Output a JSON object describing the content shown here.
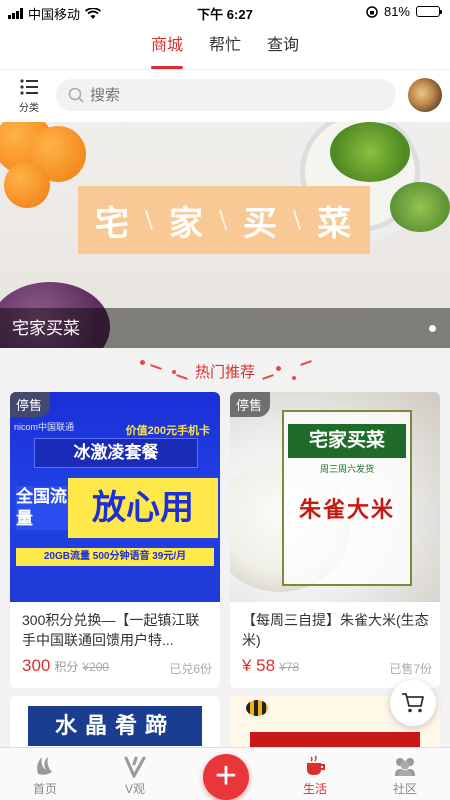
{
  "status_bar": {
    "carrier": "中国移动",
    "time": "下午 6:27",
    "battery": "81%",
    "battery_level": 0.81
  },
  "top_tabs": [
    {
      "label": "商城",
      "active": true
    },
    {
      "label": "帮忙",
      "active": false
    },
    {
      "label": "查询",
      "active": false
    }
  ],
  "search": {
    "category_label": "分类",
    "placeholder": "搜索"
  },
  "banner": {
    "title_chars": [
      "宅",
      "家",
      "买",
      "菜"
    ],
    "caption": "宅家买菜"
  },
  "section": {
    "title": "热门推荐"
  },
  "products": [
    {
      "badge": "停售",
      "title": "300积分兑换—【一起镇江联手中国联通回馈用户特...",
      "price": "300",
      "price_unit": "积分",
      "original_price": "¥200",
      "sold": "已兑6份",
      "poster": {
        "top_text": "价值200元手机卡",
        "logo": "nicom中国联通",
        "headline": "冰激凌套餐",
        "left_text": "全国流量",
        "big_text": "放心用",
        "strip": "20GB流量 500分钟语音 39元/月"
      }
    },
    {
      "badge": "停售",
      "title": "【每周三自提】朱雀大米(生态米)",
      "price": "¥ 58",
      "price_unit": "",
      "original_price": "¥78",
      "sold": "已售7份",
      "poster": {
        "title": "宅家买菜",
        "subtitle": "周三周六发货",
        "rice": "朱雀大米"
      }
    }
  ],
  "partial_products": [
    {
      "poster_text": "水晶肴蹄"
    }
  ],
  "bottom_nav": [
    {
      "label": "首页",
      "icon": "home-icon",
      "active": false
    },
    {
      "label": "V观",
      "icon": "v-icon",
      "active": false
    },
    {
      "label": "生活",
      "icon": "cup-icon",
      "active": true
    },
    {
      "label": "社区",
      "icon": "community-icon",
      "active": false
    }
  ],
  "colors": {
    "accent": "#d9302f",
    "add_button": "#e8363b"
  }
}
